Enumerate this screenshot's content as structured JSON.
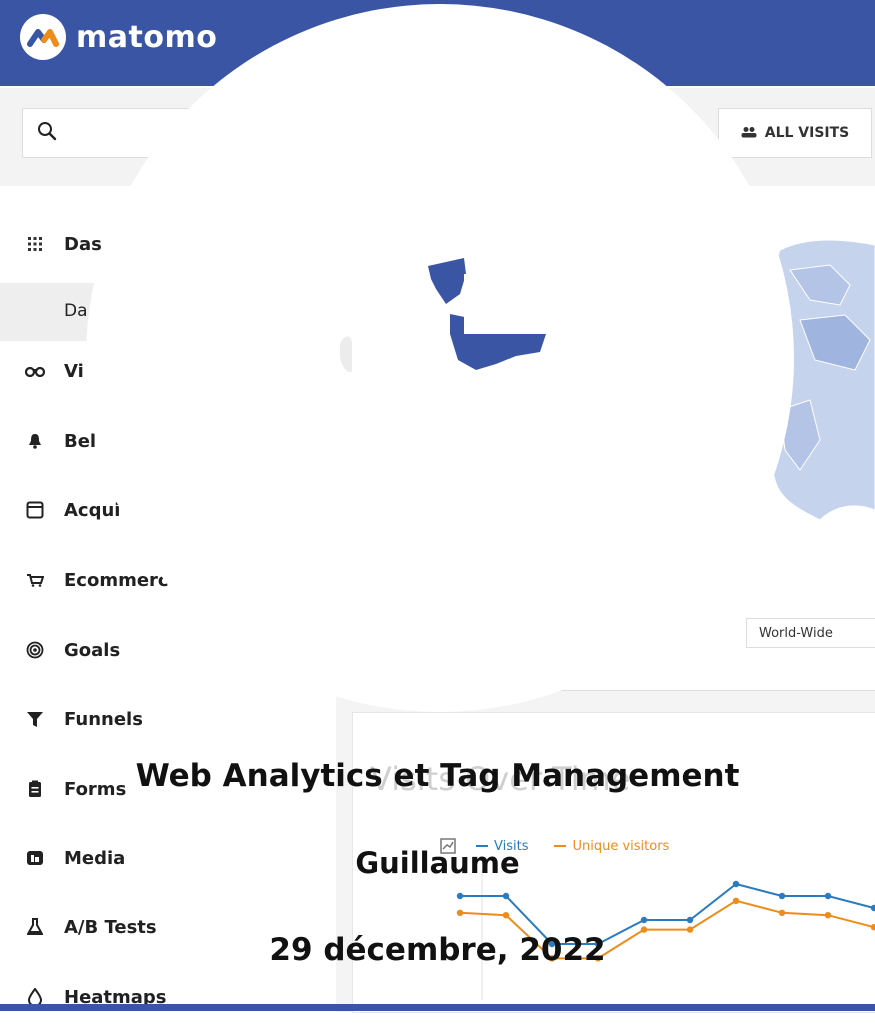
{
  "header": {
    "brand": "matomo",
    "colors": {
      "header_bg": "#3b55a5",
      "accent_blue": "#3b55a5"
    }
  },
  "toolbar": {
    "search_icon": "search-icon",
    "segment_button_label": "ALL VISITS"
  },
  "sidebar": {
    "items": [
      {
        "label": "Das",
        "icon": "grid-icon"
      },
      {
        "label": "Vi",
        "icon": "binoculars-icon"
      },
      {
        "label": "Bel",
        "icon": "bell-icon"
      },
      {
        "label": "Acqui",
        "icon": "window-icon"
      },
      {
        "label": "Ecommerc",
        "icon": "cart-icon"
      },
      {
        "label": "Goals",
        "icon": "target-icon"
      },
      {
        "label": "Funnels",
        "icon": "funnel-icon"
      },
      {
        "label": "Forms",
        "icon": "clipboard-icon"
      },
      {
        "label": "Media",
        "icon": "video-icon"
      },
      {
        "label": "A/B Tests",
        "icon": "flask-icon"
      },
      {
        "label": "Heatmaps",
        "icon": "drop-icon"
      }
    ],
    "sub_item": "Da"
  },
  "map": {
    "region_select": "World-Wide"
  },
  "chart_widget": {
    "title": "Visits Over Time",
    "legend": [
      {
        "name": "Visits",
        "color": "#2b7bbf"
      },
      {
        "name": "Unique visitors",
        "color": "#ee8c1b"
      }
    ]
  },
  "chart_data": {
    "type": "line",
    "series": [
      {
        "name": "Visits",
        "values": [
          9,
          9,
          7,
          7,
          8,
          8,
          9.5,
          9,
          9,
          8.5
        ]
      },
      {
        "name": "Unique visitors",
        "values": [
          8.3,
          8.2,
          6.4,
          6.4,
          7.6,
          7.6,
          8.8,
          8.3,
          8.2,
          7.7
        ]
      }
    ]
  },
  "overlay": {
    "title": "Web Analytics et Tag Management",
    "author": "Guillaume",
    "date": "29 décembre, 2022"
  }
}
